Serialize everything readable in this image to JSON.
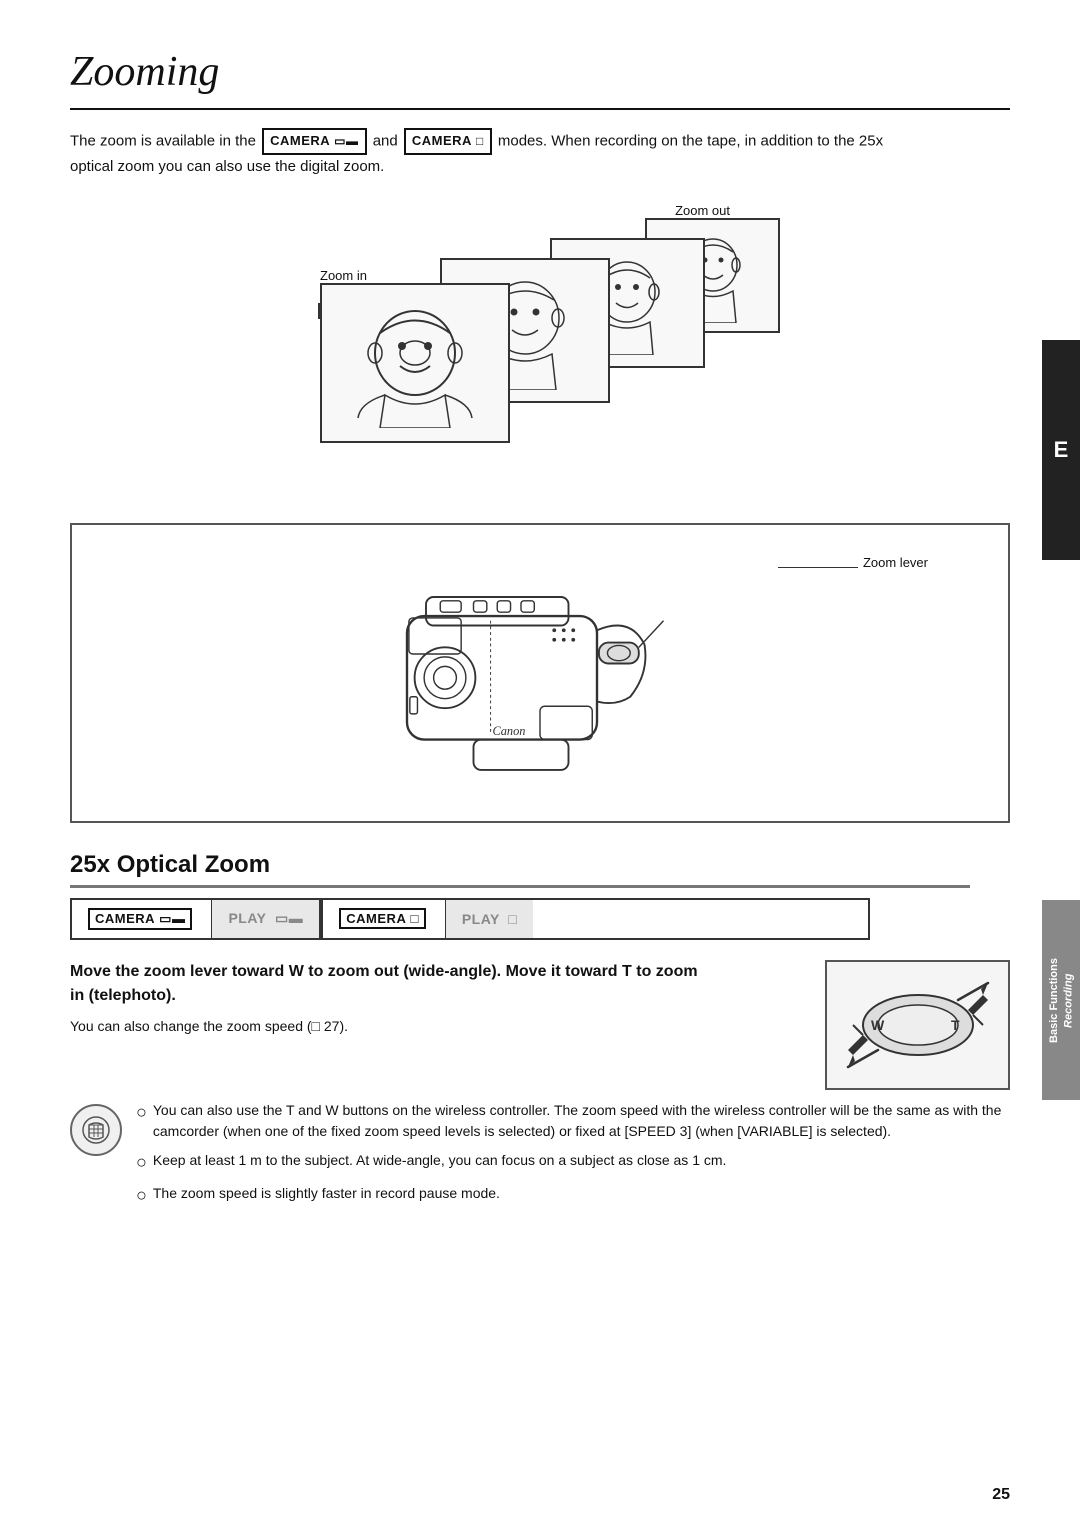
{
  "page": {
    "title": "Zooming",
    "number": "25"
  },
  "side_tab": {
    "letter": "E"
  },
  "section_tab": {
    "line1": "Basic Functions",
    "line2": "Recording"
  },
  "intro": {
    "text_before": "The zoom is available in the",
    "camera1": "CAMERA",
    "symbol1": "☰",
    "text_middle": "and",
    "camera2": "CAMERA",
    "symbol2": "⊡",
    "text_after": "modes. When recording on the tape, in addition to the 25x optical zoom you can also use the digital zoom."
  },
  "zoom_diagram": {
    "zoom_out_label": "Zoom out",
    "zoom_in_label": "Zoom in"
  },
  "camcorder_section": {
    "zoom_lever_label": "Zoom lever"
  },
  "optical_zoom": {
    "heading": "25x Optical Zoom"
  },
  "mode_bar": {
    "items": [
      {
        "label": "CAMERA",
        "symbol": "☰",
        "active": true
      },
      {
        "label": "PLAY",
        "symbol": "☰",
        "active": false
      },
      {
        "label": "CAMERA",
        "symbol": "⊡",
        "active": true
      },
      {
        "label": "PLAY",
        "symbol": "⊡",
        "active": false
      }
    ]
  },
  "instruction": {
    "main": "Move the zoom lever toward W to zoom out (wide-angle). Move it toward T to zoom in (telephoto).",
    "sub": "You can also change the zoom speed (□ 27)."
  },
  "notes": [
    "You can also use the T and W buttons on the wireless controller. The zoom speed with the wireless controller will be the same as with the camcorder (when one of the fixed zoom speed levels is selected) or fixed at [SPEED 3] (when [VARIABLE] is selected).",
    "Keep at least 1 m to the subject. At wide-angle, you can focus on a subject as close as 1 cm.",
    "The zoom speed is slightly faster in record pause mode."
  ]
}
